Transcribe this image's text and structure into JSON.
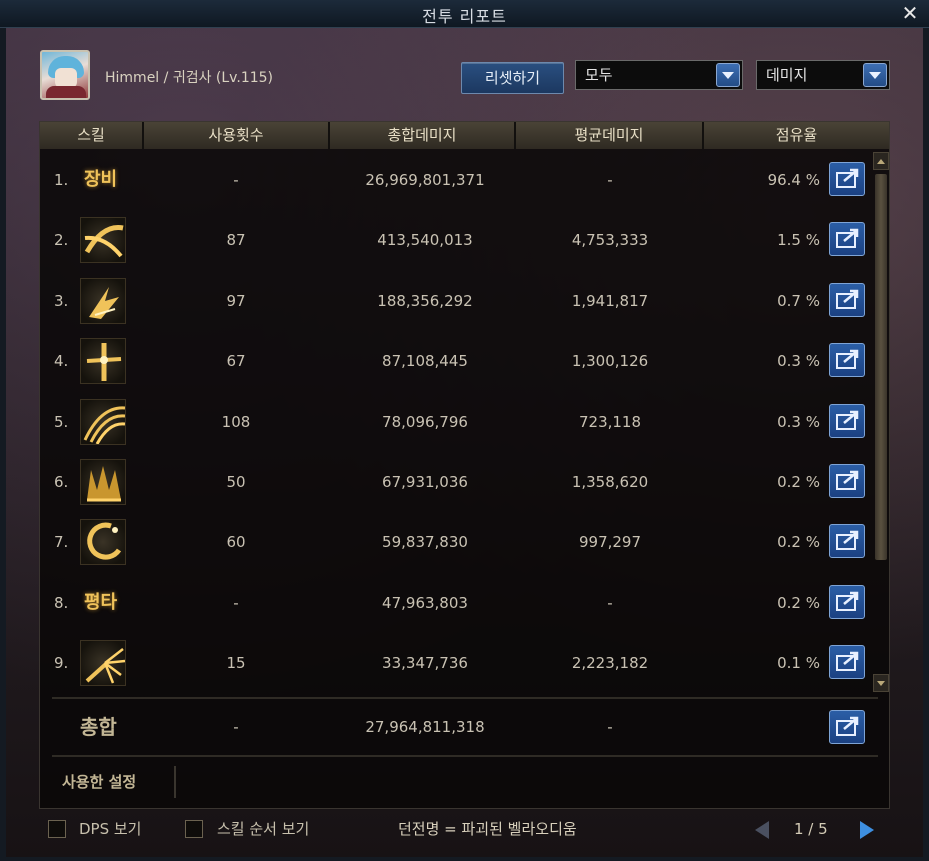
{
  "window": {
    "title": "전투 리포트"
  },
  "player": {
    "name": "Himmel / 귀검사 (Lv.115)"
  },
  "controls": {
    "reset_label": "리셋하기",
    "filter_value": "모두",
    "metric_value": "데미지"
  },
  "table": {
    "headers": [
      "스킬",
      "사용횟수",
      "총합데미지",
      "평균데미지",
      "점유율"
    ],
    "rows": [
      {
        "rank": "1.",
        "skill_text": "장비",
        "icon": "equipment-text",
        "uses": "-",
        "total": "26,969,801,371",
        "avg": "-",
        "share": "96.4 %"
      },
      {
        "rank": "2.",
        "skill_text": "",
        "icon": "crescent-slash-icon",
        "uses": "87",
        "total": "413,540,013",
        "avg": "4,753,333",
        "share": "1.5 %"
      },
      {
        "rank": "3.",
        "skill_text": "",
        "icon": "burst-claw-icon",
        "uses": "97",
        "total": "188,356,292",
        "avg": "1,941,817",
        "share": "0.7 %"
      },
      {
        "rank": "4.",
        "skill_text": "",
        "icon": "cross-blade-icon",
        "uses": "67",
        "total": "87,108,445",
        "avg": "1,300,126",
        "share": "0.3 %"
      },
      {
        "rank": "5.",
        "skill_text": "",
        "icon": "fan-slash-icon",
        "uses": "108",
        "total": "78,096,796",
        "avg": "723,118",
        "share": "0.3 %"
      },
      {
        "rank": "6.",
        "skill_text": "",
        "icon": "flame-wave-icon",
        "uses": "50",
        "total": "67,931,036",
        "avg": "1,358,620",
        "share": "0.2 %"
      },
      {
        "rank": "7.",
        "skill_text": "",
        "icon": "moon-ring-icon",
        "uses": "60",
        "total": "59,837,830",
        "avg": "997,297",
        "share": "0.2 %"
      },
      {
        "rank": "8.",
        "skill_text": "평타",
        "icon": "basic-attack-text",
        "uses": "-",
        "total": "47,963,803",
        "avg": "-",
        "share": "0.2 %"
      },
      {
        "rank": "9.",
        "skill_text": "",
        "icon": "spark-burst-icon",
        "uses": "15",
        "total": "33,347,736",
        "avg": "2,223,182",
        "share": "0.1 %"
      }
    ],
    "total": {
      "label": "총합",
      "uses": "-",
      "total": "27,964,811,318",
      "avg": "-"
    },
    "settings_label": "사용한 설정"
  },
  "footer": {
    "dps_label": "DPS 보기",
    "order_label": "스킬 순서 보기",
    "dungeon": "던전명 = 파괴된 벨라오디움",
    "page": "1 / 5"
  },
  "colors": {
    "accent_gold": "#f0c35a",
    "button_blue": "#2b5ea6",
    "page_next_blue": "#3e8fe0"
  }
}
